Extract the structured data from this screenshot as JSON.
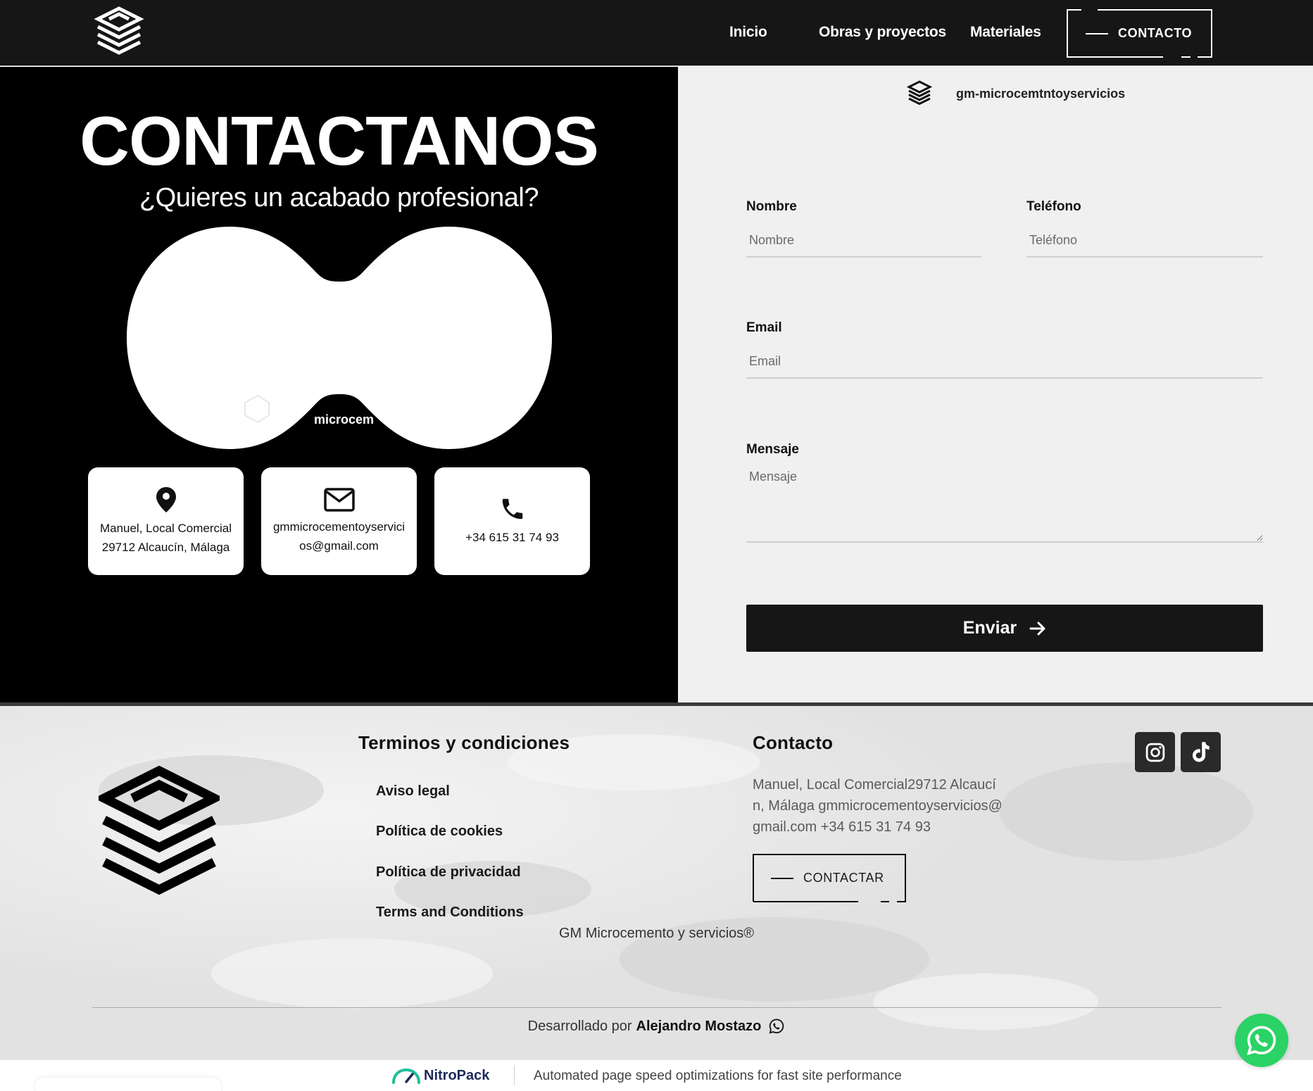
{
  "header": {
    "nav": [
      {
        "label": "Inicio"
      },
      {
        "label": "Obras y proyectos"
      },
      {
        "label": "Materiales"
      }
    ],
    "cta_label": "CONTACTO"
  },
  "hero": {
    "title": "CONTACTANOS",
    "subtitle": "¿Quieres un acabado profesional?",
    "blob_overlay_text": "microcem"
  },
  "info_cards": [
    {
      "icon": "location-pin-icon",
      "text": "Manuel, Local Comercial29712 Alcaucín, Málaga"
    },
    {
      "icon": "envelope-icon",
      "text": "gmmicrocementoyservicios@gmail.com"
    },
    {
      "icon": "phone-icon",
      "text": "+34 615 31 74 93"
    }
  ],
  "form": {
    "instagram_handle": "gm-microcemtntoyservicios",
    "nombre": {
      "label": "Nombre",
      "placeholder": "Nombre",
      "value": ""
    },
    "telefono": {
      "label": "Teléfono",
      "placeholder": "Teléfono",
      "value": ""
    },
    "email": {
      "label": "Email",
      "placeholder": "Email",
      "value": ""
    },
    "mensaje": {
      "label": "Mensaje",
      "placeholder": "Mensaje",
      "value": ""
    },
    "submit_label": "Enviar"
  },
  "footer": {
    "terms_heading": "Terminos y condiciones",
    "links": [
      {
        "label": "Aviso legal"
      },
      {
        "label": "Política de cookies"
      },
      {
        "label": "Política de privacidad"
      },
      {
        "label": "Terms and Conditions"
      }
    ],
    "contact_heading": "Contacto",
    "contact_text": "Manuel, Local Comercial29712 Alcaucín, Málaga gmmicrocementoyservicios@gmail.com +34 615 31 74 93",
    "contact_button": "CONTACTAR",
    "social": [
      {
        "icon": "instagram-icon"
      },
      {
        "icon": "tiktok-icon"
      }
    ],
    "copyright": "GM Microcemento y servicios®",
    "developer_prefix": "Desarrollado por",
    "developer_name": "Alejandro Mostazo"
  },
  "nitropack": {
    "brand": "NitroPack",
    "tagline": "Automated page speed optimizations for fast site performance"
  },
  "colors": {
    "header_bg": "#161616",
    "hero_bg": "#000000",
    "form_bg": "#f0f0f0",
    "whatsapp": "#2bd266",
    "nitro_accent": "#1fbf9a",
    "nitro_text": "#1c2b5a"
  }
}
